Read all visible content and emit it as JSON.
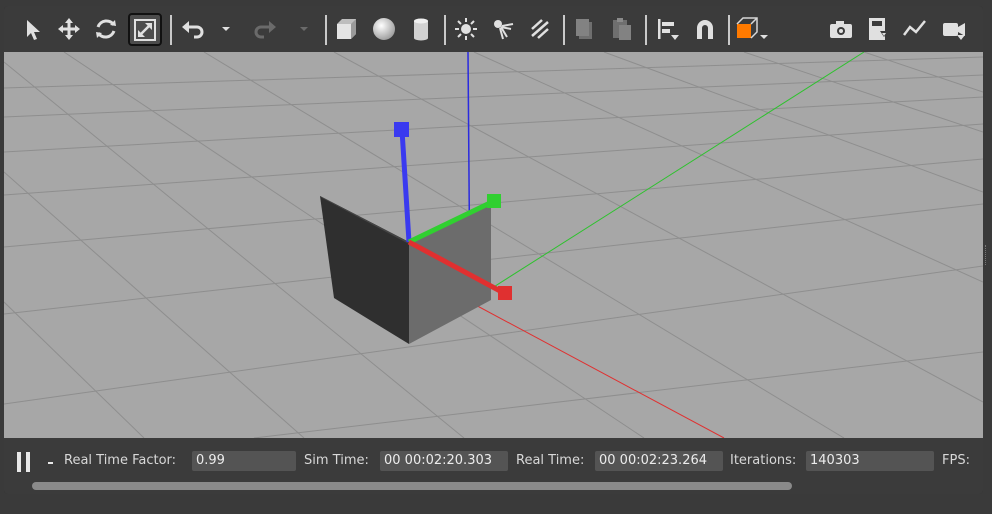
{
  "toolbar": {
    "tools": [
      {
        "icon": "select-arrow-icon"
      },
      {
        "icon": "translate-icon"
      },
      {
        "icon": "rotate-icon"
      },
      {
        "icon": "scale-icon",
        "active": true
      },
      {
        "icon": "undo-icon"
      },
      {
        "icon": "undo-history-icon"
      },
      {
        "icon": "redo-icon"
      },
      {
        "icon": "redo-history-icon"
      },
      {
        "icon": "box-shape-icon"
      },
      {
        "icon": "sphere-shape-icon"
      },
      {
        "icon": "cylinder-shape-icon"
      },
      {
        "icon": "point-light-icon"
      },
      {
        "icon": "spot-light-icon"
      },
      {
        "icon": "directional-light-icon"
      },
      {
        "icon": "copy-icon"
      },
      {
        "icon": "paste-icon"
      },
      {
        "icon": "align-icon"
      },
      {
        "icon": "snap-icon"
      },
      {
        "icon": "view-angle-icon"
      },
      {
        "icon": "screenshot-icon"
      },
      {
        "icon": "log-icon"
      },
      {
        "icon": "plot-icon"
      },
      {
        "icon": "video-record-icon"
      }
    ]
  },
  "status": {
    "real_time_factor_label": "Real Time Factor:",
    "real_time_factor": "0.99",
    "sim_time_label": "Sim Time:",
    "sim_time": "00 00:02:20.303",
    "real_time_label": "Real Time:",
    "real_time": "00 00:02:23.264",
    "iterations_label": "Iterations:",
    "iterations": "140303",
    "fps_label": "FPS:",
    "step_label": "-"
  },
  "colors": {
    "x_axis": "#e03030",
    "y_axis": "#2ec22e",
    "z_axis": "#2a2ae0",
    "ground": "#a7a7a7",
    "grid": "#8c8c8c",
    "accent": "#ff7a00"
  }
}
